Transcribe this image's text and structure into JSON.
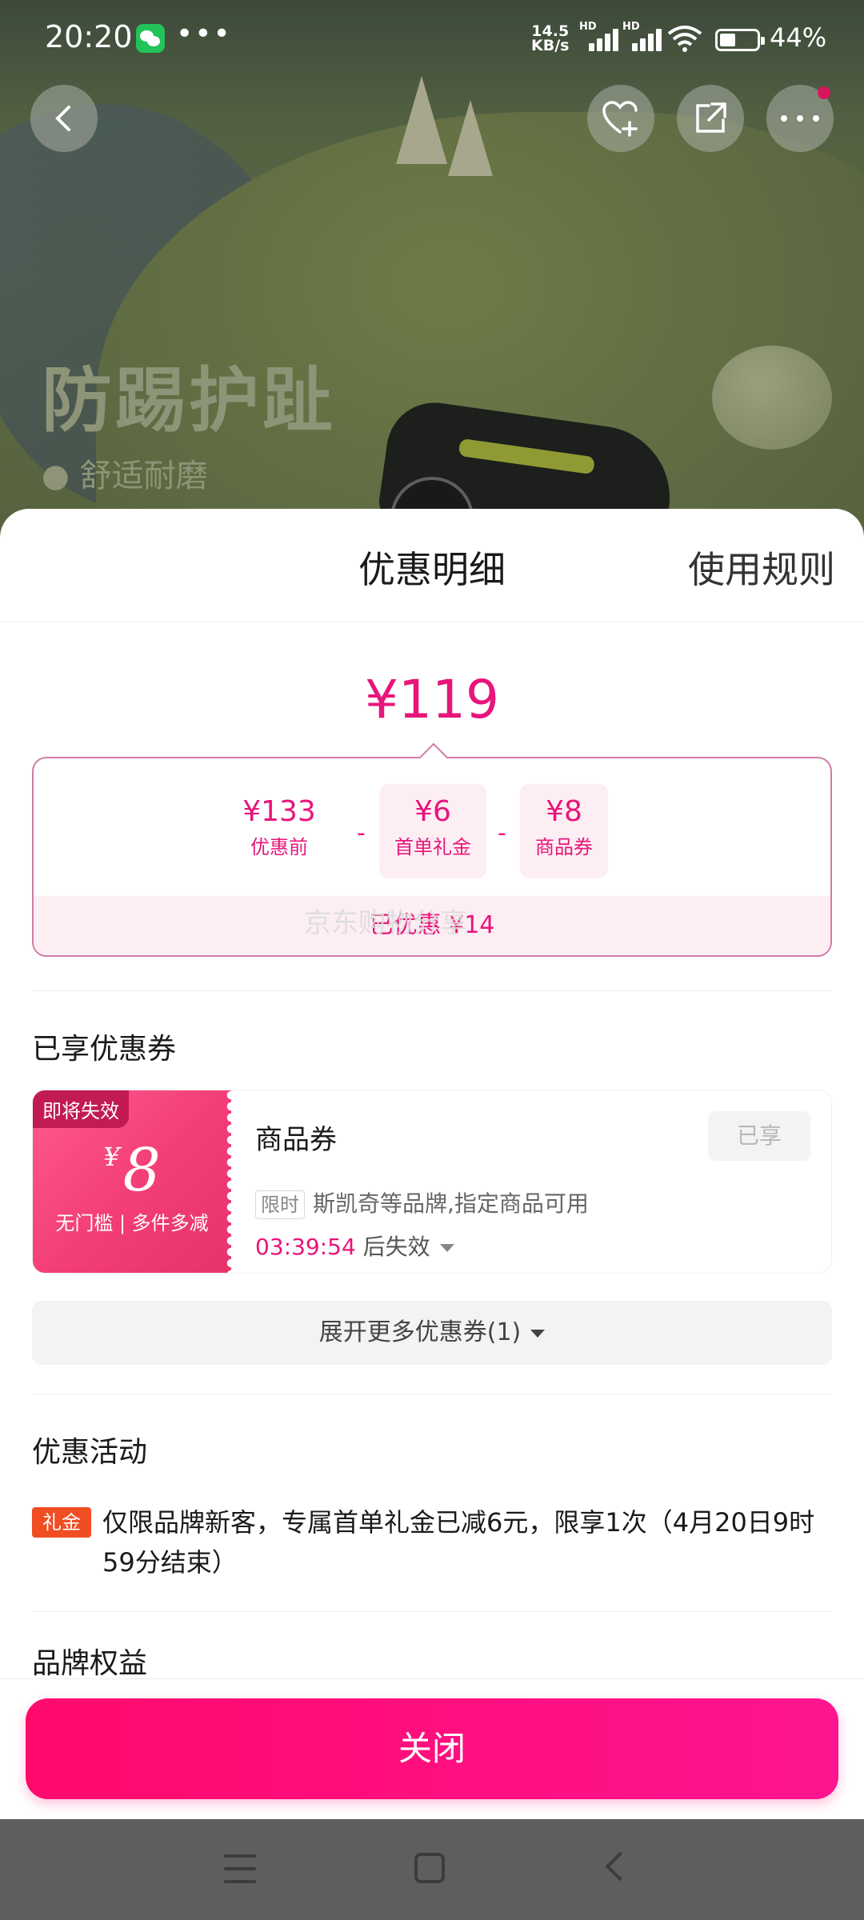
{
  "status_bar": {
    "time": "20:20",
    "more_dots": "•••",
    "net_speed_value": "14.5",
    "net_speed_unit": "KB/s",
    "battery_percent": "44%",
    "battery_level": 0.44
  },
  "background": {
    "headline": "防踢护趾",
    "subline": "● 舒适耐磨"
  },
  "sheet": {
    "title": "优惠明细",
    "rules_link": "使用规则",
    "final_price": "¥119",
    "breakdown": {
      "original": {
        "amount": "¥133",
        "label": "优惠前"
      },
      "minus": "-",
      "gift": {
        "amount": "¥6",
        "label": "首单礼金"
      },
      "coupon": {
        "amount": "¥8",
        "label": "商品券"
      },
      "saved": "已优惠 ¥14"
    },
    "watermark": "京东购物分享",
    "coupons_section_title": "已享优惠券",
    "coupon": {
      "expire_tag": "即将失效",
      "currency": "¥",
      "value": "8",
      "condition": "无门槛 | 多件多减",
      "name": "商品券",
      "status_button": "已享",
      "limit_tag": "限时",
      "description": "斯凯奇等品牌,指定商品可用",
      "countdown": "03:39:54",
      "countdown_suffix": "后失效"
    },
    "expand_more": "展开更多优惠券(1)",
    "activities_section_title": "优惠活动",
    "activity": {
      "tag": "礼金",
      "text": "仅限品牌新客，专属首单礼金已减6元，限享1次（4月20日9时59分结束）"
    },
    "brand_section_title": "品牌权益",
    "close_button": "关闭"
  },
  "colors": {
    "accent": "#e8157a",
    "close_button": "#ff0a6c",
    "gift_tag": "#f04d22"
  }
}
